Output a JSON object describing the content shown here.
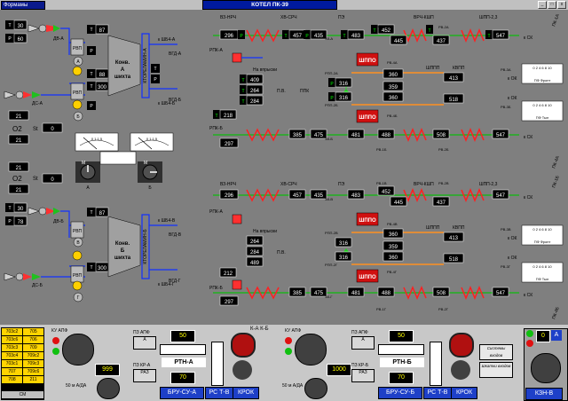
{
  "window": {
    "menu": "Формамы",
    "title": "КОТЕЛ ПК-39"
  },
  "ctl": {
    "sep": "К-А   К-Б"
  },
  "left": {
    "a": {
      "tv": [
        "30",
        "60",
        "2"
      ],
      "dv": "ДВ-А",
      "ds": "ДС-А",
      "rvp": "РВП",
      "t": [
        "41",
        "42"
      ],
      "p": "3",
      "a": "А",
      "b": "Б",
      "tt": [
        "95",
        "96"
      ],
      "l": [
        "31",
        "35"
      ],
      "kp": [
        "87",
        "300",
        "88"
      ],
      "konv1": "Конв.",
      "konv2": "А",
      "konv3": "шихта",
      "ktor": "КТОРЕЛАМИН-А",
      "kshba": "к ШБ4-А",
      "kshbb": "к ШБ4-Б",
      "vgda": "ВГД-А",
      "vgdb": "ВГД-Б",
      "pd": "2"
    },
    "b": {
      "tv": [
        "30",
        "78",
        "58"
      ],
      "dv": "ДВ-Б",
      "ds": "ДС-Б",
      "rvp": "РВП",
      "t": [
        "87",
        "131"
      ],
      "v": "В",
      "g": "Г",
      "tt": [
        "87",
        "300"
      ],
      "konv1": "Конв.",
      "konv2": "Б",
      "konv3": "шихта",
      "ktor": "КТОРЕЛАМИН-Б",
      "kshbv": "к ШБ4-В",
      "kshbg": "к ШБ4-Г",
      "vgdv": "ВГД-В",
      "vgdg": "ВГД-Г"
    },
    "o2a": {
      "v1": "21",
      "v2": "21",
      "o2": "O2",
      "st": "St",
      "val": "0"
    },
    "o2b": {
      "v1": "21",
      "v2": "21",
      "o2": "O2",
      "st": "St",
      "val": "0"
    },
    "meters": {
      "a": "А",
      "b": "Б",
      "m": "М",
      "scale": "0   1   1.5"
    }
  },
  "right": {
    "hdr": {
      "vz": "ВЗ-НРЧ",
      "hv": "ХВ-СРЧ",
      "pe": "ПЭ",
      "vrch": "ВРЧ-КШП",
      "shpp": "ШПП-2,3",
      "rp": "РПК-А",
      "rpb": "РПК-Б",
      "shpp1": "ШППО",
      "ppk": "ППК",
      "pv": "П.В.",
      "vp": "На впрыски",
      "shpp_n": "ШППО"
    },
    "a": {
      "t1": "296",
      "p1": "305",
      "t2": "457",
      "p2": "435",
      "r1": "483",
      "ra": "433",
      "t3": "418",
      "r2": "407",
      "v1": "409",
      "v2": "264",
      "v3": "284",
      "v4": "489",
      "p3": "316",
      "p4": "316",
      "g1": "1",
      "c1": "360",
      "c2": "359",
      "c3": "413",
      "c4": "518",
      "s1": "452",
      "s2": "445",
      "s3": "437",
      "s4": "29",
      "s5": "547",
      "r3": "473",
      "r4": "461",
      "r5": "459",
      "b1": "297",
      "b2": "385",
      "b3": "475",
      "b4": "481",
      "b5": "488",
      "b6": "508",
      "b7": "547",
      "e1": "29",
      "e2": "3",
      "e3": "2",
      "mp": "24",
      "ma": "ПФ Фронт",
      "mb": "ПФ Тыл",
      "ok1": "к ОК",
      "ok2": "к ОК",
      "sk1": "к СК",
      "sk2": "к СК",
      "rv1": "РВ-1А",
      "rv2": "РВ-2А",
      "rv3": "РВ-1Б",
      "rv4": "РВ-2Б",
      "rv5": "РВ-4А",
      "rv6": "РВ-3А",
      "rv7": "РВ-4Б",
      "rv8": "РВ-3Б",
      "rpp1": "РПП-2А",
      "rpp2": "РПП-2Б",
      "pz": "ПЗ-1А",
      "pzb": "ПЗ-1Б",
      "zv1": "ЗВ-А",
      "zv2": "ЗВ-Б",
      "pk1": "ПК-1А",
      "pk2": "ПК-2А",
      "pk3": "ПК-3А",
      "pk4": "ПК-4А",
      "kvpp": "КВПП",
      "shpp": "ШППП",
      "r6": "212",
      "r7": "218"
    },
    "b": {
      "t1": "296",
      "p1": "305",
      "t2": "457",
      "p2": "435",
      "r1": "483",
      "ra": "433",
      "t3": "418",
      "r2": "407",
      "v1": "409",
      "v2": "264",
      "v3": "284",
      "v4": "489",
      "p3": "316",
      "p4": "316",
      "c1": "360",
      "c2": "359",
      "c3": "413",
      "c4": "518",
      "s1": "452",
      "s2": "445",
      "s3": "437",
      "s4": "29",
      "s5": "547",
      "r3": "473",
      "r4": "461",
      "r5": "459",
      "b1": "297",
      "b2": "385",
      "b3": "475",
      "b4": "481",
      "b5": "488",
      "b6": "508",
      "b7": "547",
      "ok1": "к ОК",
      "ok2": "к ОК",
      "sk1": "к СК",
      "sk2": "к СК",
      "rv1": "РВ-1В",
      "rv2": "РВ-2В",
      "rv3": "РВ-1Г",
      "rv4": "РВ-2Г",
      "rv5": "РВ-4В",
      "rv6": "РВ-3В",
      "rv7": "РВ-4Г",
      "rv8": "РВ-3Г",
      "rpp1": "РПП-2В",
      "rpp2": "РПП-2Г",
      "pz": "ПЗ-1В",
      "pzb": "ПЗ-1Г",
      "zv1": "ЗВ-В",
      "zv2": "ЗВ-Г",
      "pk1": "ПК-1Б",
      "pk2": "ПК-2Б",
      "pk3": "ПК-3Б",
      "pk4": "ПК-4Б",
      "kvpp": "КВПП",
      "shpp": "ШППП",
      "r6": "212",
      "r7": "218"
    }
  },
  "panel": {
    "alarms": [
      "703с2",
      "705",
      "703с6",
      "706",
      "703с3",
      "709",
      "703с4",
      "709с2",
      "703с1",
      "709с3",
      "707",
      "709с6",
      "708",
      "211"
    ],
    "kvit": "СМ",
    "a": {
      "kuapf": "КУ АПФ",
      "m1": "50 м А/ДА",
      "sp1": "999",
      "apf": "ПЗ АПФ",
      "sp2": "50",
      "rtn": "РТН-А",
      "sp3": "70",
      "bru": "БРУ-СУ-А",
      "rs": "РС Т-В",
      "krok": "КРОК",
      "apf2": "ПЗ КР-А",
      "pz": "РАЗ",
      "ap": "А",
      "r": "Р"
    },
    "b": {
      "kuapf": "КУ АПФ",
      "m1": "50 м А/ДА",
      "sp1": "1000",
      "apf": "ПЗ АПФ",
      "sp2": "50",
      "rtn": "РТН-Б",
      "sp3": "70",
      "bru": "БРУ-СУ-Б",
      "rs": "РС Т-В",
      "krok": "КРОК",
      "apf2": "ПЗ КР-Б",
      "pz": "РАЗ",
      "ap": "А",
      "r": "Р"
    },
    "sysbtn": "Системы входов",
    "sysbtn2": "Шкатки входов",
    "kzn": "КЗН-В",
    "kzn_sp": "0",
    "kzn_a": "А"
  }
}
